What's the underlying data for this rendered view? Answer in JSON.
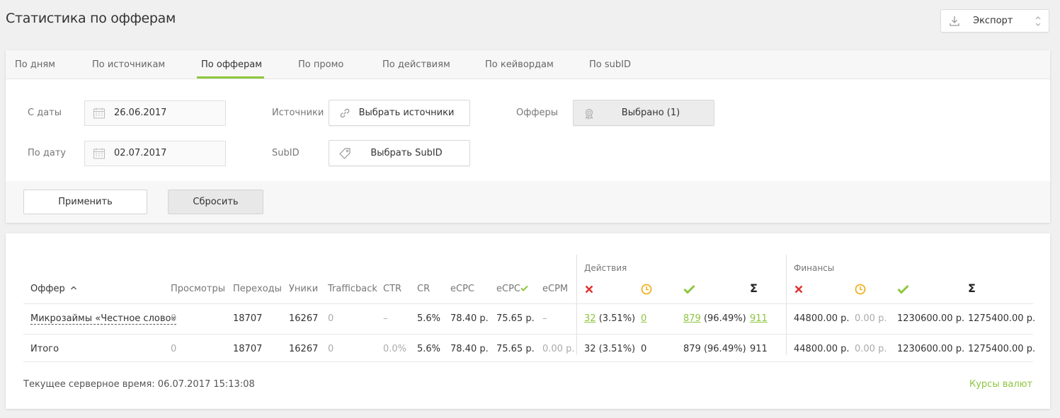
{
  "page": {
    "title": "Статистика по офферам"
  },
  "export": {
    "label": "Экспорт"
  },
  "tabs": [
    {
      "label": "По дням"
    },
    {
      "label": "По источникам"
    },
    {
      "label": "По офферам"
    },
    {
      "label": "По промо"
    },
    {
      "label": "По действиям"
    },
    {
      "label": "По кейвордам"
    },
    {
      "label": "По subID"
    }
  ],
  "filters": {
    "date_from_label": "С даты",
    "date_from": "26.06.2017",
    "date_to_label": "По дату",
    "date_to": "02.07.2017",
    "sources_label": "Источники",
    "sources_button": "Выбрать источники",
    "subid_label": "SubID",
    "subid_button": "Выбрать SubID",
    "offers_label": "Офферы",
    "offers_button": "Выбрано (1)"
  },
  "actions": {
    "apply": "Применить",
    "reset": "Сбросить"
  },
  "table": {
    "group_actions": "Действия",
    "group_finance": "Финансы",
    "headers": {
      "offer": "Оффер",
      "views": "Просмотры",
      "clicks": "Переходы",
      "uniques": "Уники",
      "trafficback": "Trafficback",
      "ctr": "CTR",
      "cr": "CR",
      "ecpc": "eCPC",
      "ecpc2": "eCPC",
      "ecpm": "eCPM",
      "sum": "Σ"
    },
    "row": {
      "offer": "Микрозаймы «Честное слово»",
      "views": "0",
      "clicks": "18707",
      "uniques": "16267",
      "trafficback": "0",
      "ctr": "–",
      "cr": "5.6%",
      "ecpc": "78.40 р.",
      "ecpc2": "75.65 р.",
      "ecpm": "–",
      "rejected_count": "32",
      "rejected_pct": "(3.51%)",
      "pending": "0",
      "approved_count": "879",
      "approved_pct": "(96.49%)",
      "total_actions": "911",
      "fin_rejected": "44800.00 р.",
      "fin_pending": "0.00 р.",
      "fin_approved": "1230600.00 р.",
      "fin_total": "1275400.00 р."
    },
    "total": {
      "label": "Итого",
      "views": "0",
      "clicks": "18707",
      "uniques": "16267",
      "trafficback": "0",
      "ctr": "0.0%",
      "cr": "5.6%",
      "ecpc": "78.40 р.",
      "ecpc2": "75.65 р.",
      "ecpm": "0.00 р.",
      "rejected": "32 (3.51%)",
      "pending": "0",
      "approved": "879 (96.49%)",
      "total_actions": "911",
      "fin_rejected": "44800.00 р.",
      "fin_pending": "0.00 р.",
      "fin_approved": "1230600.00 р.",
      "fin_total": "1275400.00 р."
    }
  },
  "footer": {
    "server_time": "Текущее серверное время: 06.07.2017 15:13:08",
    "rates_link": "Курсы валют"
  },
  "colors": {
    "accent": "#8dc63f",
    "reject": "#e0312f",
    "pending": "#f2b01e"
  }
}
